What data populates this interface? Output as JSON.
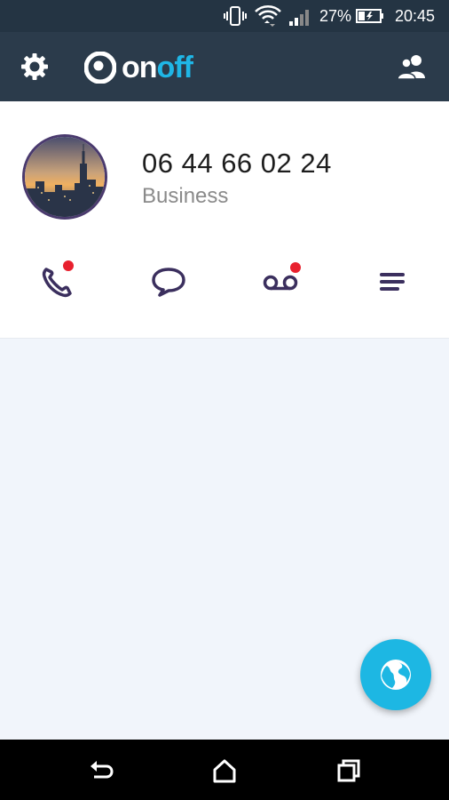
{
  "status_bar": {
    "battery_percent": "27%",
    "time": "20:45",
    "icons": [
      "vibrate-icon",
      "wifi-icon",
      "signal-icon",
      "battery-charging-icon"
    ]
  },
  "app_bar": {
    "logo_on": "on",
    "logo_off": "off",
    "icons": [
      "settings-gear-icon",
      "onoff-logo-icon",
      "contacts-icon"
    ]
  },
  "profile": {
    "phone_number": "06 44 66 02 24",
    "line_label": "Business",
    "avatar": "city-skyline-avatar"
  },
  "actions": [
    {
      "name": "calls",
      "icon": "phone-icon",
      "has_notification": true
    },
    {
      "name": "messages",
      "icon": "chat-bubble-icon",
      "has_notification": false
    },
    {
      "name": "voicemail",
      "icon": "voicemail-icon",
      "has_notification": true
    },
    {
      "name": "menu",
      "icon": "menu-icon",
      "has_notification": false
    }
  ],
  "fab": {
    "icon": "globe-icon"
  },
  "nav_bar": {
    "icons": [
      "back-icon",
      "home-icon",
      "recents-icon"
    ]
  },
  "colors": {
    "status_bar": "#243443",
    "app_bar": "#2b3b4b",
    "accent": "#1db7e3",
    "icon_purple": "#3b2f5e",
    "notification": "#e8202e",
    "background": "#f1f5fb"
  }
}
